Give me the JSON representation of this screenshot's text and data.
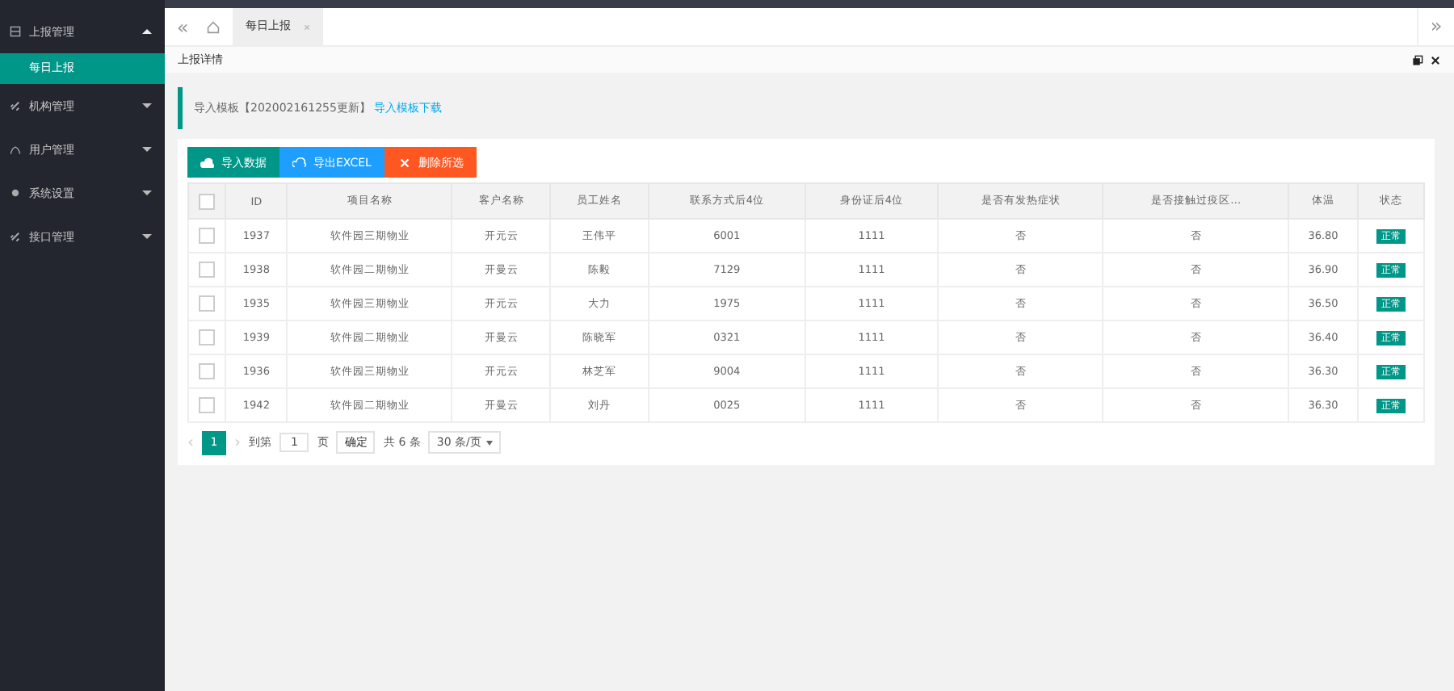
{
  "sidebar": {
    "items": [
      {
        "label": "上报管理",
        "expanded": true,
        "children": [
          {
            "label": "每日上报",
            "selected": true
          }
        ]
      },
      {
        "label": "机构管理",
        "expanded": false
      },
      {
        "label": "用户管理",
        "expanded": false
      },
      {
        "label": "系统设置",
        "expanded": false
      },
      {
        "label": "接口管理",
        "expanded": false
      }
    ]
  },
  "tabbar": {
    "collapse": "«",
    "expand": "»"
  },
  "tabs": [
    {
      "label": "每日上报",
      "selected": true
    }
  ],
  "panel_title": "上报详情",
  "notice": {
    "text": "导入模板【202002161255更新】",
    "link": "导入模板下载"
  },
  "buttons": [
    {
      "label": "导入数据",
      "kind": "import"
    },
    {
      "label": "导出EXCEL",
      "kind": "export"
    },
    {
      "label": "删除所选",
      "kind": "delete"
    }
  ],
  "table": {
    "select_all_checked": false,
    "columns": [
      "ID",
      "项目名称",
      "客户名称",
      "员工姓名",
      "联系方式后4位",
      "身份证后4位",
      "是否有发热症状",
      "是否接触过疫区…",
      "体温",
      "状态"
    ],
    "rows": [
      {
        "selected": false,
        "cells": [
          "1937",
          "软件园三期物业",
          "开元云",
          "王伟平",
          "6001",
          "1111",
          "否",
          "否",
          "36.80"
        ],
        "status": "正常"
      },
      {
        "selected": false,
        "cells": [
          "1938",
          "软件园二期物业",
          "开曼云",
          "陈毅",
          "7129",
          "1111",
          "否",
          "否",
          "36.90"
        ],
        "status": "正常"
      },
      {
        "selected": false,
        "cells": [
          "1935",
          "软件园三期物业",
          "开元云",
          "大力",
          "1975",
          "1111",
          "否",
          "否",
          "36.50"
        ],
        "status": "正常"
      },
      {
        "selected": false,
        "cells": [
          "1939",
          "软件园二期物业",
          "开曼云",
          "陈晓军",
          "0321",
          "1111",
          "否",
          "否",
          "36.40"
        ],
        "status": "正常"
      },
      {
        "selected": false,
        "cells": [
          "1936",
          "软件园三期物业",
          "开元云",
          "林芝军",
          "9004",
          "1111",
          "否",
          "否",
          "36.30"
        ],
        "status": "正常"
      },
      {
        "selected": false,
        "cells": [
          "1942",
          "软件园二期物业",
          "开曼云",
          "刘丹",
          "0025",
          "1111",
          "否",
          "否",
          "36.30"
        ],
        "status": "正常"
      }
    ]
  },
  "pagination": {
    "prev": "‹",
    "next": "›",
    "pages": [
      {
        "label": "1",
        "selected": true
      }
    ],
    "goto_label": "到第",
    "page_value": "1",
    "page_unit": "页",
    "confirm": "确定",
    "total": "共 6 条",
    "page_size": "30 条/页"
  }
}
